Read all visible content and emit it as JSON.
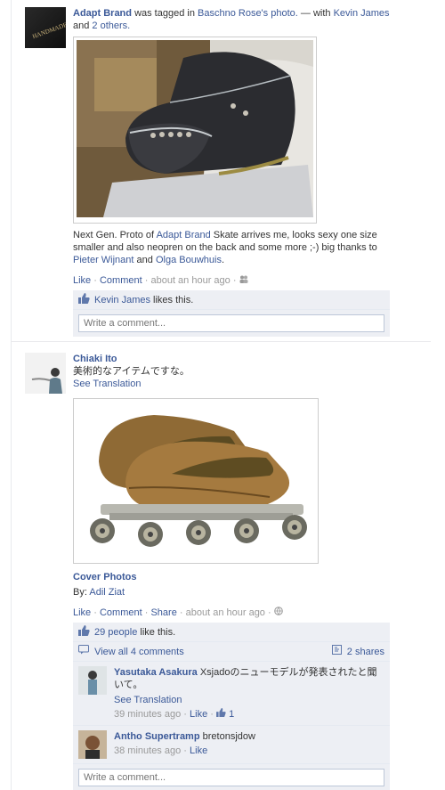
{
  "post1": {
    "actor": "Adapt Brand",
    "tagged_text": "was tagged in",
    "photo_owner": "Baschno Rose's",
    "photo_word": "photo.",
    "with_text": "— with",
    "with_person": "Kevin James",
    "and_text": "and",
    "others": "2 others.",
    "caption_part1": "Next Gen. Proto of",
    "caption_brand": "Adapt Brand",
    "caption_part2": "Skate arrives me, looks sexy one size smaller and also neopren on the back and some more ;-) big thanks to",
    "caption_name1": "Pieter Wijnant",
    "caption_and": "and",
    "caption_name2": "Olga Bouwhuis",
    "caption_end": ".",
    "like": "Like",
    "dot": "·",
    "comment": "Comment",
    "time": "about an hour ago",
    "liker": "Kevin James",
    "likes_this": "likes this.",
    "comment_placeholder": "Write a comment..."
  },
  "post2": {
    "actor": "Chiaki Ito",
    "message": "美術的なアイテムですな。",
    "see_translation": "See Translation",
    "album_title": "Cover Photos",
    "by_label": "By:",
    "by_name": "Adil Ziat",
    "like": "Like",
    "comment": "Comment",
    "share": "Share",
    "time": "about an hour ago",
    "likes_count": "29 people",
    "likes_suffix": "like this.",
    "view_comments": "View all 4 comments",
    "shares": "2 shares",
    "comments": [
      {
        "author": "Yasutaka Asakura",
        "text": "Xsjadoのニューモデルが発表されたと聞いて。",
        "see_translation": "See Translation",
        "time": "39 minutes ago",
        "like": "Like",
        "like_count": "1"
      },
      {
        "author": "Antho Supertramp",
        "text": "bretonsjdow",
        "time": "38 minutes ago",
        "like": "Like"
      }
    ],
    "comment_placeholder": "Write a comment..."
  },
  "icons": {
    "thumb": "thumbs-up-icon",
    "friends": "friends-audience-icon",
    "globe": "globe-public-icon",
    "comment": "comment-bubble-icon",
    "share": "share-icon"
  },
  "colors": {
    "link": "#3b5998",
    "ufi_bg": "#edeff4"
  }
}
